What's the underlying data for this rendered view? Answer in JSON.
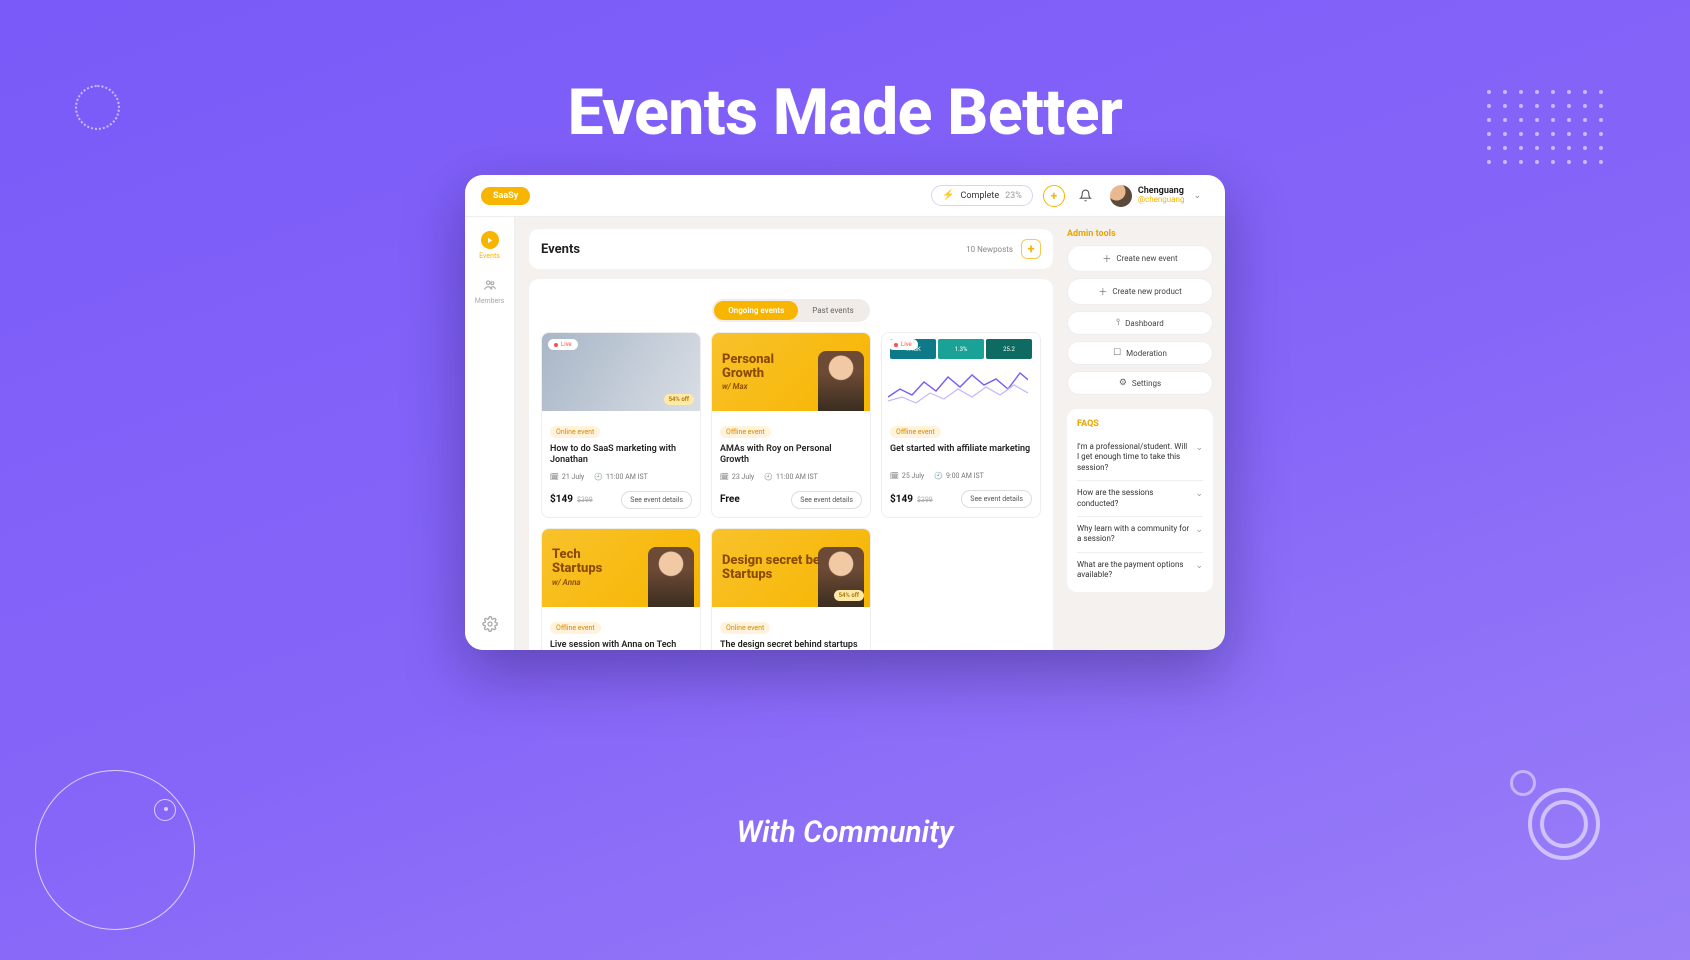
{
  "hero": {
    "title": "Events Made Better",
    "subtitle": "With Community"
  },
  "topbar": {
    "logo": "SaaSy",
    "complete_label": "Complete",
    "complete_pct": "23%",
    "user": {
      "name": "Chenguang",
      "handle": "@chenguang"
    }
  },
  "nav": {
    "items": [
      {
        "label": "Events",
        "active": true
      },
      {
        "label": "Members",
        "active": false
      }
    ]
  },
  "events": {
    "heading": "Events",
    "newposts": "10 Newposts",
    "tabs": {
      "ongoing": "Ongoing events",
      "past": "Past events",
      "active": "ongoing"
    },
    "details_label": "See event details",
    "list": [
      {
        "live": "Live",
        "discount": "54% off",
        "tag": "Online event",
        "title": "How to do SaaS marketing with Jonathan",
        "date": "21 July",
        "time": "11:00 AM IST",
        "price": "$149",
        "old_price": "$399",
        "cover": "photo"
      },
      {
        "tag": "Offline event",
        "title": "AMAs with Roy on Personal Growth",
        "date": "23 July",
        "time": "11:00 AM IST",
        "price": "Free",
        "cover": "yellow",
        "cover_big": "Personal Growth",
        "cover_sub": "w/ Max"
      },
      {
        "live": "Live",
        "tag": "Offline event",
        "title": "Get started with affiliate marketing",
        "date": "25 July",
        "time": "9:00 AM IST",
        "price": "$149",
        "old_price": "$399",
        "cover": "chart",
        "chart_labels": [
          "17.6K",
          "1.3%",
          "25.2"
        ]
      },
      {
        "tag": "Offline event",
        "title": "Live session with Anna on Tech Startups",
        "cover": "yellow",
        "cover_big": "Tech Startups",
        "cover_sub": "w/ Anna"
      },
      {
        "discount": "54% off",
        "tag": "Online event",
        "title": "The design secret behind startups by Ashutosh",
        "cover": "yellow",
        "cover_big": "Design secret behind Startups",
        "cover_sub": ""
      }
    ]
  },
  "admin": {
    "heading": "Admin tools",
    "buttons": [
      {
        "icon": "＋",
        "label": "Create new event"
      },
      {
        "icon": "＋",
        "label": "Create new product"
      },
      {
        "icon": "⫯",
        "label": "Dashboard"
      },
      {
        "icon": "☐",
        "label": "Moderation"
      },
      {
        "icon": "⚙",
        "label": "Settings"
      }
    ]
  },
  "faqs": {
    "heading": "FAQS",
    "items": [
      "I'm a professional/student. Will I get enough time to take this session?",
      "How are the sessions conducted?",
      "Why learn with a community for a session?",
      "What are the payment options available?"
    ]
  }
}
